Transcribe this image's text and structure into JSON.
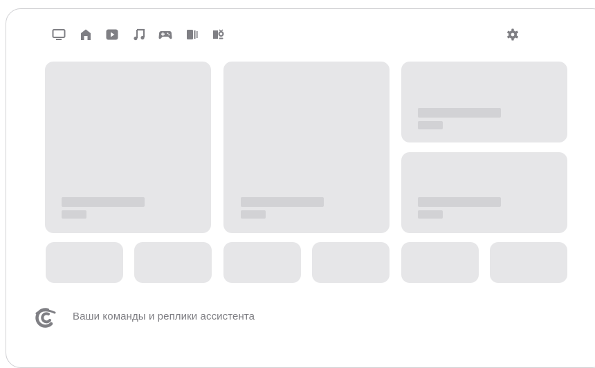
{
  "nav": {
    "icons": [
      "tv-icon",
      "home-icon",
      "video-play-icon",
      "music-icon",
      "gamepad-icon",
      "book-icon",
      "kids-icon"
    ],
    "settings_icon": "gear-icon"
  },
  "colors": {
    "icon": "#7f7f84",
    "card": "#e6e6e8",
    "placeholder": "#d2d2d5",
    "text": "#7d7d82"
  },
  "footer": {
    "assistant_icon": "assistant-logo-icon",
    "text": "Ваши команды и реплики ассистента"
  }
}
